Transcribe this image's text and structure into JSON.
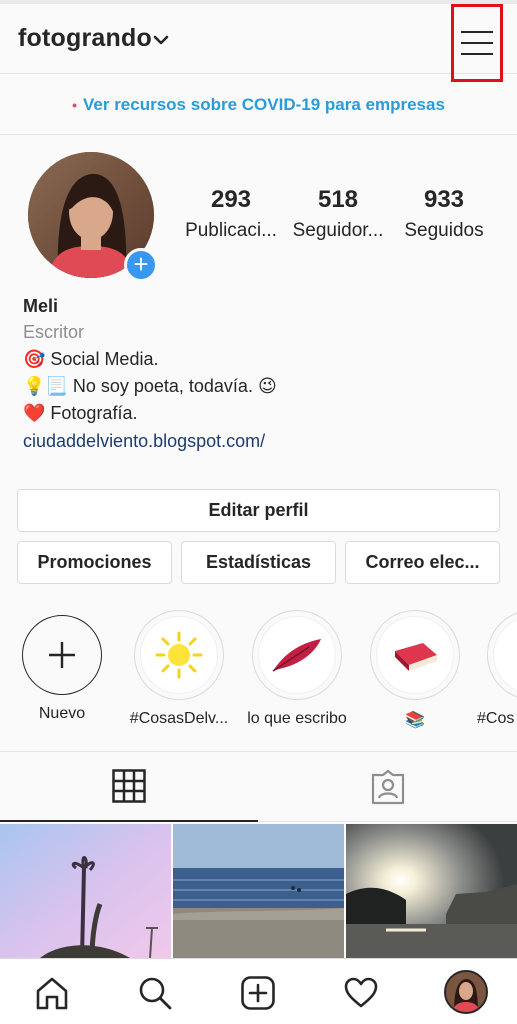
{
  "header": {
    "username": "fotogrando",
    "dropdown_icon": "chevron-down-icon",
    "menu_icon": "hamburger-menu-icon"
  },
  "banner": {
    "text": "Ver recursos sobre COVID-19 para empresas",
    "dot": "•",
    "color": "#2b9cd8"
  },
  "profile": {
    "add_story_icon": "plus-icon",
    "add_story_symbol": "+",
    "stats": [
      {
        "value": "293",
        "label": "Publicaci..."
      },
      {
        "value": "518",
        "label": "Seguidor..."
      },
      {
        "value": "933",
        "label": "Seguidos"
      }
    ],
    "name": "Meli",
    "category": "Escritor",
    "bio_lines": [
      "🎯 Social Media.",
      "💡📃 No soy poeta, todavía. 😉",
      "❤️ Fotografía."
    ],
    "link": "ciudaddelviento.blogspot.com/"
  },
  "buttons": {
    "edit_profile": "Editar perfil",
    "promotions": "Promociones",
    "statistics": "Estadísticas",
    "email": "Correo elec..."
  },
  "highlights": [
    {
      "label": "Nuevo",
      "icon": "plus-icon"
    },
    {
      "label": "#CosasDelv...",
      "icon": "sun-icon"
    },
    {
      "label": "lo que escribo",
      "icon": "feather-icon"
    },
    {
      "label": "📚",
      "icon": "book-icon"
    },
    {
      "label": "#Cos",
      "icon": "highlight-cover"
    }
  ],
  "tabs": [
    {
      "name": "grid",
      "icon": "grid-icon",
      "active": true
    },
    {
      "name": "tagged",
      "icon": "tagged-user-icon",
      "active": false
    }
  ],
  "nav": [
    {
      "icon": "home-icon"
    },
    {
      "icon": "search-icon"
    },
    {
      "icon": "add-post-icon"
    },
    {
      "icon": "heart-icon"
    },
    {
      "icon": "profile-avatar"
    }
  ],
  "colors": {
    "accent": "#3897f0",
    "highlight_border": "#e0101a",
    "link": "#1c3d6e"
  }
}
